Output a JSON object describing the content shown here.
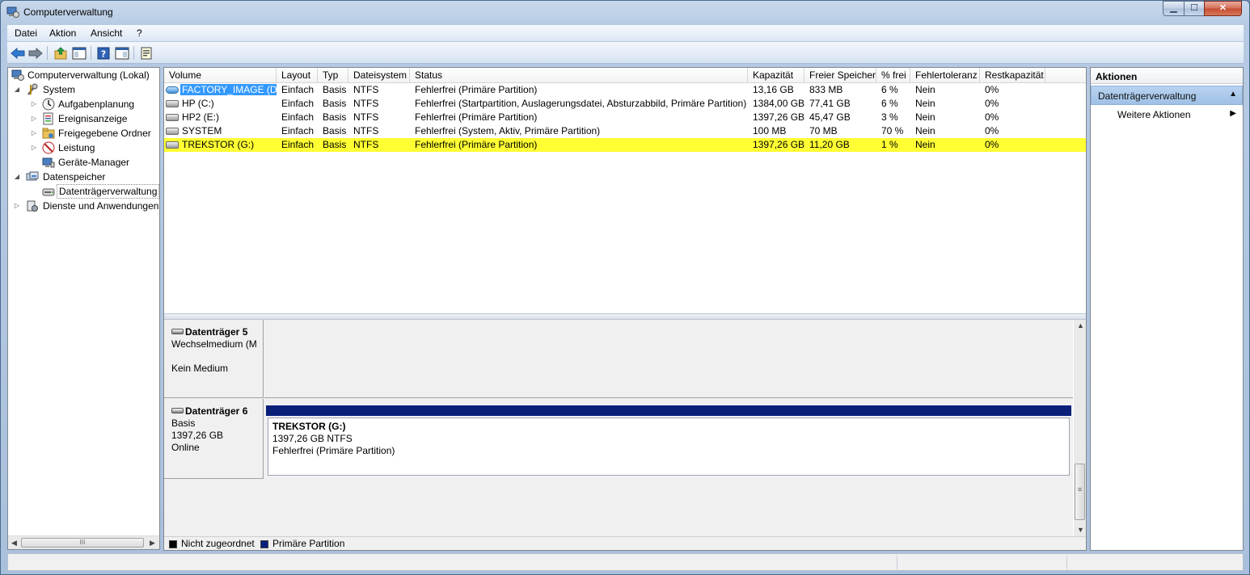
{
  "window": {
    "title": "Computerverwaltung",
    "buttons": {
      "minimize": "▁",
      "maximize": "☐",
      "close": "✕"
    }
  },
  "menu": [
    "Datei",
    "Aktion",
    "Ansicht",
    "?"
  ],
  "toolbar": {
    "icons": [
      "back-arrow-icon",
      "forward-arrow-icon",
      "up-folder-icon",
      "show-hide-console-tree-icon",
      "help-icon",
      "show-hide-action-pane-icon",
      "properties-icon"
    ],
    "colors": {
      "back": "#2f7ad3",
      "forward": "#7a8794"
    }
  },
  "tree": {
    "items": [
      {
        "label": "Computerverwaltung (Lokal)",
        "expander": "",
        "icon": "computer-management-icon"
      },
      {
        "label": "System",
        "expander": "◢",
        "icon": "tools-icon"
      },
      {
        "label": "Aufgabenplanung",
        "expander": "▷",
        "icon": "clock-icon"
      },
      {
        "label": "Ereignisanzeige",
        "expander": "▷",
        "icon": "event-viewer-icon"
      },
      {
        "label": "Freigegebene Ordner",
        "expander": "▷",
        "icon": "shared-folder-icon"
      },
      {
        "label": "Leistung",
        "expander": "▷",
        "icon": "performance-icon"
      },
      {
        "label": "Geräte-Manager",
        "expander": "",
        "icon": "device-manager-icon"
      },
      {
        "label": "Datenspeicher",
        "expander": "◢",
        "icon": "storage-icon"
      },
      {
        "label": "Datenträgerverwaltung",
        "expander": "",
        "icon": "disk-management-icon"
      },
      {
        "label": "Dienste und Anwendungen",
        "expander": "▷",
        "icon": "services-icon"
      }
    ],
    "scroll_thumb_label": "III"
  },
  "volume_list": {
    "columns": [
      "Volume",
      "Layout",
      "Typ",
      "Dateisystem",
      "Status",
      "Kapazität",
      "Freier Speicher",
      "% frei",
      "Fehlertoleranz",
      "Restkapazität"
    ],
    "rows": [
      {
        "volume": "FACTORY_IMAGE (D:)",
        "layout": "Einfach",
        "typ": "Basis",
        "fs": "NTFS",
        "status": "Fehlerfrei (Primäre Partition)",
        "capacity": "13,16 GB",
        "free": "833 MB",
        "pct": "6 %",
        "fault": "Nein",
        "rest": "0%"
      },
      {
        "volume": "HP (C:)",
        "layout": "Einfach",
        "typ": "Basis",
        "fs": "NTFS",
        "status": "Fehlerfrei (Startpartition, Auslagerungsdatei, Absturzabbild, Primäre Partition)",
        "capacity": "1384,00 GB",
        "free": "77,41 GB",
        "pct": "6 %",
        "fault": "Nein",
        "rest": "0%"
      },
      {
        "volume": "HP2 (E:)",
        "layout": "Einfach",
        "typ": "Basis",
        "fs": "NTFS",
        "status": "Fehlerfrei (Primäre Partition)",
        "capacity": "1397,26 GB",
        "free": "45,47 GB",
        "pct": "3 %",
        "fault": "Nein",
        "rest": "0%"
      },
      {
        "volume": "SYSTEM",
        "layout": "Einfach",
        "typ": "Basis",
        "fs": "NTFS",
        "status": "Fehlerfrei (System, Aktiv, Primäre Partition)",
        "capacity": "100 MB",
        "free": "70 MB",
        "pct": "70 %",
        "fault": "Nein",
        "rest": "0%"
      },
      {
        "volume": "TREKSTOR (G:)",
        "layout": "Einfach",
        "typ": "Basis",
        "fs": "NTFS",
        "status": "Fehlerfrei (Primäre Partition)",
        "capacity": "1397,26 GB",
        "free": "11,20 GB",
        "pct": "1 %",
        "fault": "Nein",
        "rest": "0%"
      }
    ],
    "highlight_color": "#ffff33",
    "selection_color": "#3399ff"
  },
  "disks": [
    {
      "name": "Datenträger 5",
      "line1": "Wechselmedium (M",
      "line2": "",
      "line3": "Kein Medium"
    },
    {
      "name": "Datenträger 6",
      "line1": "Basis",
      "line2": "1397,26 GB",
      "line3": "Online",
      "partition": {
        "name": "TREKSTOR  (G:)",
        "size": "1397,26 GB NTFS",
        "status": "Fehlerfrei (Primäre Partition)"
      }
    }
  ],
  "legend": [
    {
      "label": "Nicht zugeordnet",
      "color": "#000000"
    },
    {
      "label": "Primäre Partition",
      "color": "#0a1f7a"
    }
  ],
  "actions": {
    "header": "Aktionen",
    "section": "Datenträgerverwaltung",
    "items": [
      "Weitere Aktionen"
    ]
  }
}
